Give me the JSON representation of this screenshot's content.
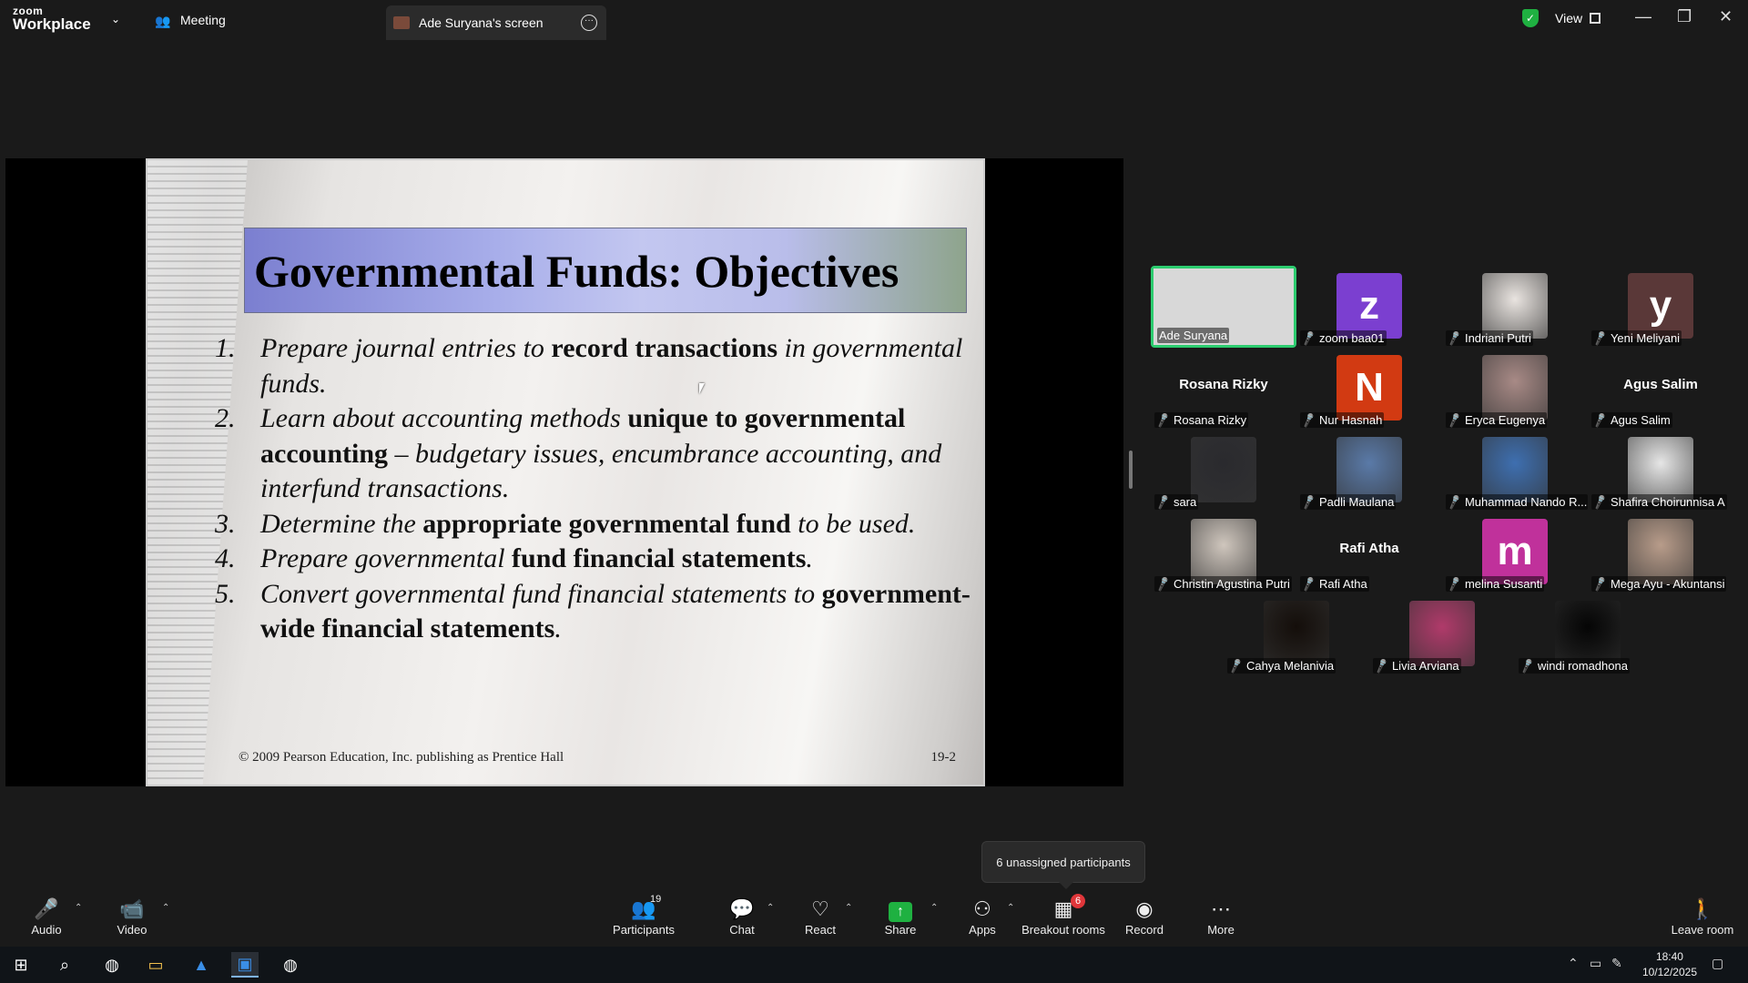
{
  "app": {
    "logo_line1": "zoom",
    "logo_line2": "Workplace"
  },
  "tabs": {
    "meeting": "Meeting",
    "screen": "Ade Suryana's screen"
  },
  "view_label": "View",
  "slide": {
    "title": "Governmental Funds: Objectives",
    "items": [
      {
        "num": "1.",
        "parts": [
          [
            "i",
            "Prepare journal entries to "
          ],
          [
            "b",
            "record transactions"
          ],
          [
            "i",
            " in governmental funds."
          ]
        ]
      },
      {
        "num": "2.",
        "parts": [
          [
            "i",
            "Learn about accounting methods "
          ],
          [
            "b",
            "unique to governmental accounting"
          ],
          [
            "i",
            " – budgetary issues, encumbrance accounting, and interfund transactions."
          ]
        ]
      },
      {
        "num": "3.",
        "parts": [
          [
            "i",
            "Determine the "
          ],
          [
            "b",
            "appropriate governmental fund"
          ],
          [
            "i",
            " to be used."
          ]
        ]
      },
      {
        "num": "4.",
        "parts": [
          [
            "i",
            "Prepare governmental "
          ],
          [
            "b",
            "fund financial statements"
          ],
          [
            "i",
            "."
          ]
        ]
      },
      {
        "num": "5.",
        "parts": [
          [
            "i",
            "Convert governmental fund financial statements to "
          ],
          [
            "b",
            "government-wide financial statements"
          ],
          [
            "i",
            "."
          ]
        ]
      }
    ],
    "footer_left": "© 2009 Pearson Education, Inc. publishing as Prentice Hall",
    "footer_right": "19-2"
  },
  "participants_tiles": [
    {
      "name": "Ade Suryana",
      "active": true
    },
    {
      "name": "zoom baa01",
      "initial": "z",
      "color": "#7b3fd0"
    },
    {
      "name": "Indriani Putri",
      "photo": "#e9e4e0"
    },
    {
      "name": "Yeni Meliyani",
      "initial": "y",
      "color": "#5a3838"
    },
    {
      "name": "Rosana Rizky",
      "big": "Rosana Rizky"
    },
    {
      "name": "Nur Hasnah",
      "initial": "N",
      "color": "#d23a12"
    },
    {
      "name": "Eryca Eugenya",
      "photo": "#a88a86"
    },
    {
      "name": "Agus Salim",
      "big": "Agus Salim"
    },
    {
      "name": "sara",
      "photo": "#2a2a2e"
    },
    {
      "name": "Padli Maulana",
      "photo": "#5a7aa8"
    },
    {
      "name": "Muhammad Nando R...",
      "photo": "#3e6fb0"
    },
    {
      "name": "Shafira Choirunnisa A",
      "photo": "#e6e6e6"
    },
    {
      "name": "Christin Agustina Putri",
      "photo": "#cfc6bd"
    },
    {
      "name": "Rafi Atha",
      "big": "Rafi Atha"
    },
    {
      "name": "melina Susanti",
      "initial": "m",
      "color": "#c0319b"
    },
    {
      "name": "Mega Ayu - Akuntansi",
      "photo": "#b89c8a"
    },
    {
      "name": "Cahya Melanivia",
      "photo": "#140e0a"
    },
    {
      "name": "Livia Arviana",
      "photo": "#b03a6a"
    },
    {
      "name": "windi romadhona",
      "photo": "#050505"
    }
  ],
  "tooltip": "6 unassigned participants",
  "toolbar": {
    "audio": "Audio",
    "video": "Video",
    "participants": "Participants",
    "participants_count": "19",
    "chat": "Chat",
    "react": "React",
    "share": "Share",
    "apps": "Apps",
    "breakout": "Breakout rooms",
    "breakout_badge": "6",
    "record": "Record",
    "more": "More",
    "leave": "Leave room"
  },
  "taskbar": {
    "time": "18:40",
    "date": "10/12/2025"
  },
  "colors": {
    "accent_green": "#1fb141",
    "active_border": "#2ccc6f",
    "mute_red": "#e0363a"
  }
}
